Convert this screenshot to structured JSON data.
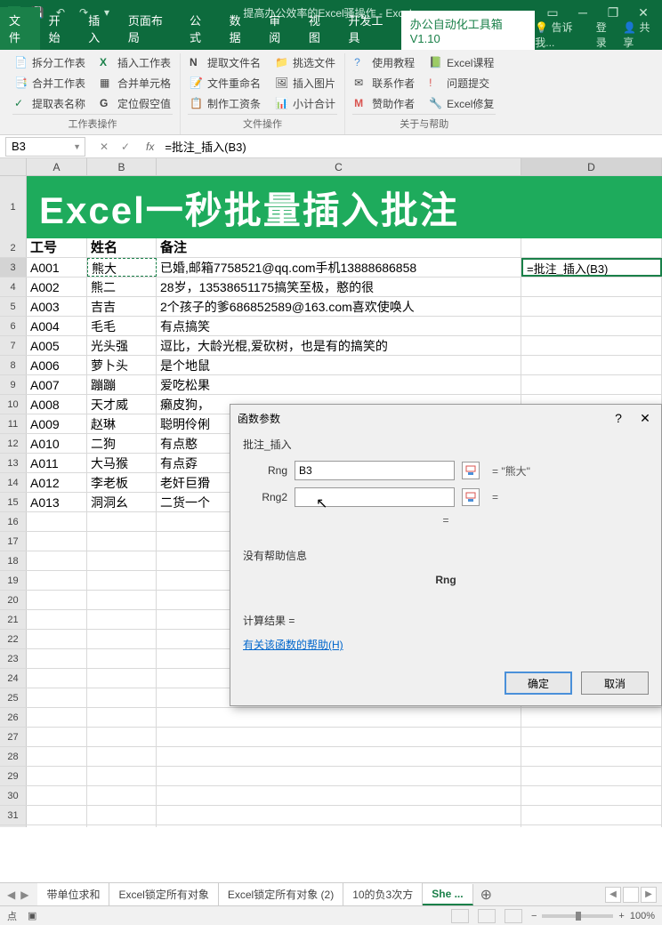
{
  "app": {
    "title": "提高办公效率的Excel骚操作 - Excel"
  },
  "menu": {
    "file": "文件",
    "home": "开始",
    "insert": "插入",
    "layout": "页面布局",
    "formula": "公式",
    "data": "数据",
    "review": "审阅",
    "view": "视图",
    "dev": "开发工具",
    "tool": "办公自动化工具箱V1.10",
    "tell": "告诉我...",
    "login": "登录",
    "share": "共享"
  },
  "ribbon": {
    "g1": {
      "a": "拆分工作表",
      "b": "插入工作表",
      "c": "合并工作表",
      "d": "合并单元格",
      "e": "提取表名称",
      "f": "定位假空值",
      "label": "工作表操作"
    },
    "g2": {
      "a": "提取文件名",
      "b": "挑选文件",
      "c": "文件重命名",
      "d": "插入图片",
      "e": "制作工资条",
      "f": "小计合计",
      "label": "文件操作"
    },
    "g3": {
      "a": "使用教程",
      "b": "Excel课程",
      "c": "联系作者",
      "d": "问题提交",
      "e": "赞助作者",
      "f": "Excel修复",
      "label": "关于与帮助"
    }
  },
  "fbar": {
    "name": "B3",
    "formula": "=批注_插入(B3)"
  },
  "cols": [
    "A",
    "B",
    "C",
    "D"
  ],
  "banner": "Excel一秒批量插入批注",
  "headers": {
    "a": "工号",
    "b": "姓名",
    "c": "备注"
  },
  "rows": [
    {
      "a": "A001",
      "b": "熊大",
      "c": "已婚,邮箱7758521@qq.com手机13888686858",
      "d": "=批注_插入(B3)"
    },
    {
      "a": "A002",
      "b": "熊二",
      "c": "28岁，13538651175搞笑至极，憨的很"
    },
    {
      "a": "A003",
      "b": "吉吉",
      "c": "2个孩子的爹686852589@163.com喜欢使唤人"
    },
    {
      "a": "A004",
      "b": "毛毛",
      "c": "有点搞笑"
    },
    {
      "a": "A005",
      "b": "光头强",
      "c": "逗比，大龄光棍,爱砍树，也是有的搞笑的"
    },
    {
      "a": "A006",
      "b": "萝卜头",
      "c": "是个地鼠"
    },
    {
      "a": "A007",
      "b": "蹦蹦",
      "c": "爱吃松果"
    },
    {
      "a": "A008",
      "b": "天才威",
      "c": "癞皮狗，"
    },
    {
      "a": "A009",
      "b": "赵琳",
      "c": "聪明伶俐"
    },
    {
      "a": "A010",
      "b": "二狗",
      "c": "有点憨"
    },
    {
      "a": "A011",
      "b": "大马猴",
      "c": "有点孬"
    },
    {
      "a": "A012",
      "b": "李老板",
      "c": "老奸巨猾"
    },
    {
      "a": "A013",
      "b": "洞洞幺",
      "c": "二货一个"
    }
  ],
  "dialog": {
    "title": "函数参数",
    "fn": "批注_插入",
    "arg1": {
      "label": "Rng",
      "value": "B3",
      "result": "\"熊大\""
    },
    "arg2": {
      "label": "Rng2",
      "value": "",
      "result": ""
    },
    "nohelp": "没有帮助信息",
    "argname": "Rng",
    "calc": "计算结果 =",
    "help": "有关该函数的帮助(H)",
    "ok": "确定",
    "cancel": "取消"
  },
  "sheets": {
    "s1": "带单位求和",
    "s2": "Excel锁定所有对象",
    "s3": "Excel锁定所有对象 (2)",
    "s4": "10的负3次方",
    "s5": "She ..."
  },
  "status": {
    "mode": "点",
    "zoom": "100%"
  }
}
